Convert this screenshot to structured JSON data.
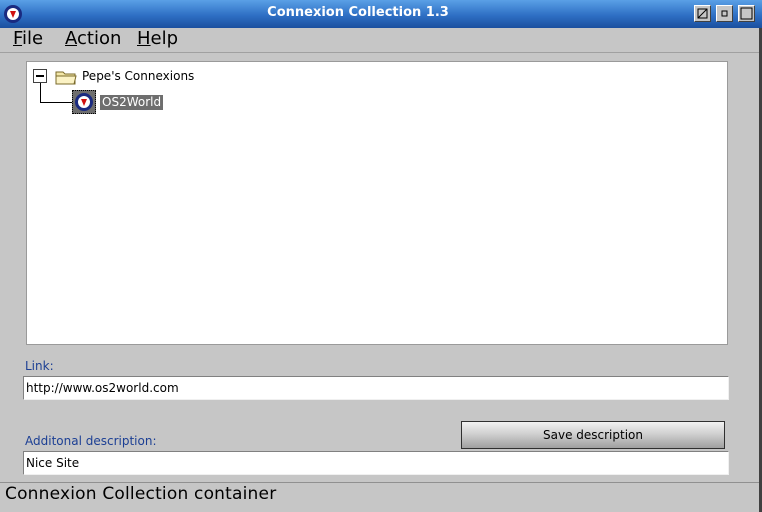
{
  "window": {
    "title": "Connexion Collection 1.3"
  },
  "menubar": {
    "file": {
      "accel": "F",
      "rest": "ile"
    },
    "action": {
      "accel": "A",
      "rest": "ction"
    },
    "help": {
      "accel": "H",
      "rest": "elp"
    }
  },
  "tree": {
    "root": {
      "label": "Pepe's Connexions",
      "expanded": true
    },
    "children": [
      {
        "label": "OS2World",
        "selected": true
      }
    ]
  },
  "link": {
    "label": "Link:",
    "value": "http://www.os2world.com"
  },
  "description": {
    "label": "Additonal description:",
    "value": "Nice Site"
  },
  "buttons": {
    "save": "Save description"
  },
  "status": {
    "text": "Connexion Collection container"
  },
  "icons": {
    "app": "connexion-app-icon",
    "folder": "folder-icon",
    "link": "globe-link-icon",
    "minimize": "minimize-icon",
    "restore": "restore-icon",
    "maximize": "maximize-icon"
  },
  "colors": {
    "titlebar": "#2e6fc4",
    "selection": "#6e6e6e",
    "label_blue": "#1c3f94"
  }
}
